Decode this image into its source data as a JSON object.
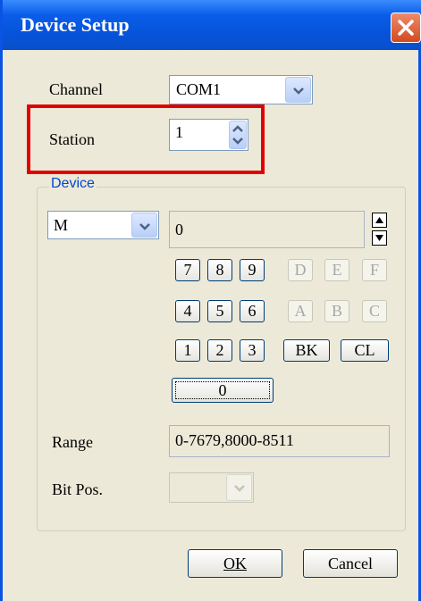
{
  "window": {
    "title": "Device Setup"
  },
  "channel": {
    "label": "Channel",
    "value": "COM1"
  },
  "station": {
    "label": "Station",
    "value": "1"
  },
  "device": {
    "group_label": "Device",
    "type_value": "M",
    "address_value": "0",
    "keypad_row1": [
      "7",
      "8",
      "9",
      "D",
      "E",
      "F"
    ],
    "keypad_row2": [
      "4",
      "5",
      "6",
      "A",
      "B",
      "C"
    ],
    "keypad_row3": [
      "1",
      "2",
      "3",
      "BK",
      "CL"
    ],
    "key_zero": "0"
  },
  "range": {
    "label": "Range",
    "value": "0-7679,8000-8511"
  },
  "bitpos": {
    "label": "Bit Pos.",
    "value": ""
  },
  "buttons": {
    "ok": "OK",
    "cancel": "Cancel"
  },
  "colors": {
    "titlebar": "#0a5ce8",
    "highlight": "#e00000",
    "group_label": "#0046d5",
    "face": "#ece9d8"
  }
}
